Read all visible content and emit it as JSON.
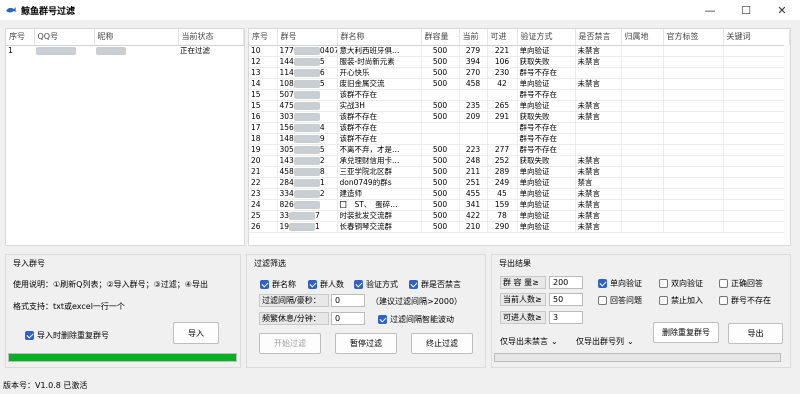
{
  "window": {
    "title": "鲸鱼群号过滤",
    "minimize": "—",
    "maximize": "☐",
    "close": "✕"
  },
  "accounts": {
    "columns": [
      "序号",
      "QQ号",
      "昵称",
      "当前状态"
    ],
    "rows": [
      {
        "index": "1",
        "status": "正在过滤"
      }
    ]
  },
  "groups": {
    "columns": [
      "序号",
      "群号",
      "群名称",
      "群容量",
      "当前",
      "可进",
      "验证方式",
      "是否禁言",
      "归属地",
      "官方标签",
      "关键词"
    ],
    "rows": [
      {
        "idx": "10",
        "num": "177",
        "num_end": "0407",
        "name": "意大利西班牙俱…",
        "cap": "500",
        "cur": "279",
        "can": "221",
        "verify": "单向验证",
        "mute": "未禁言"
      },
      {
        "idx": "12",
        "num": "144",
        "num_end": "5",
        "name": "服装-时尚新元素",
        "cap": "500",
        "cur": "394",
        "can": "106",
        "verify": "获取失败",
        "mute": "未禁言"
      },
      {
        "idx": "13",
        "num": "114",
        "num_end": "6",
        "name": "开心快乐",
        "cap": "500",
        "cur": "270",
        "can": "230",
        "verify": "群号不存在",
        "mute": ""
      },
      {
        "idx": "14",
        "num": "108",
        "num_end": "5",
        "name": "废旧金属交流",
        "cap": "500",
        "cur": "458",
        "can": "42",
        "verify": "单向验证",
        "mute": "未禁言"
      },
      {
        "idx": "15",
        "num": "507",
        "num_end": "",
        "name": "该群不存在",
        "cap": "",
        "cur": "",
        "can": "",
        "verify": "群号不存在",
        "mute": ""
      },
      {
        "idx": "15",
        "num": "475",
        "num_end": "",
        "name": "实战3H",
        "cap": "500",
        "cur": "235",
        "can": "265",
        "verify": "单向验证",
        "mute": "未禁言"
      },
      {
        "idx": "16",
        "num": "303",
        "num_end": "",
        "name": "该群不存在",
        "cap": "500",
        "cur": "209",
        "can": "291",
        "verify": "获取失败",
        "mute": "未禁言"
      },
      {
        "idx": "17",
        "num": "156",
        "num_end": "4",
        "name": "该群不存在",
        "cap": "",
        "cur": "",
        "can": "",
        "verify": "群号不存在",
        "mute": ""
      },
      {
        "idx": "18",
        "num": "148",
        "num_end": "9",
        "name": "该群不存在",
        "cap": "",
        "cur": "",
        "can": "",
        "verify": "群号不存在",
        "mute": ""
      },
      {
        "idx": "19",
        "num": "305",
        "num_end": "5",
        "name": "不离不弃，才是…",
        "cap": "500",
        "cur": "223",
        "can": "277",
        "verify": "群号不存在",
        "mute": ""
      },
      {
        "idx": "20",
        "num": "143",
        "num_end": "2",
        "name": "承兑理财信用卡…",
        "cap": "500",
        "cur": "248",
        "can": "252",
        "verify": "获取失败",
        "mute": "未禁言"
      },
      {
        "idx": "21",
        "num": "458",
        "num_end": "8",
        "name": "三亚学院北区群",
        "cap": "500",
        "cur": "211",
        "can": "289",
        "verify": "单向验证",
        "mute": "未禁言"
      },
      {
        "idx": "22",
        "num": "284",
        "num_end": "1",
        "name": "don0749的群s",
        "cap": "500",
        "cur": "251",
        "can": "249",
        "verify": "单向验证",
        "mute": "禁言"
      },
      {
        "idx": "23",
        "num": "334",
        "num_end": "2",
        "name": "建造师",
        "cap": "500",
        "cur": "455",
        "can": "45",
        "verify": "单向验证",
        "mute": "未禁言"
      },
      {
        "idx": "24",
        "num": "826",
        "num_end": "",
        "name": "囗　ST、　蛋碎…",
        "cap": "500",
        "cur": "341",
        "can": "159",
        "verify": "单向验证",
        "mute": "未禁言"
      },
      {
        "idx": "25",
        "num": "33",
        "num_end": "7",
        "name": "时装批发交流群",
        "cap": "500",
        "cur": "422",
        "can": "78",
        "verify": "单向验证",
        "mute": "未禁言"
      },
      {
        "idx": "26",
        "num": "19",
        "num_end": "1",
        "name": "长春铜琴交流群",
        "cap": "500",
        "cur": "210",
        "can": "290",
        "verify": "单向验证",
        "mute": "未禁言"
      }
    ]
  },
  "import": {
    "title": "导入群号",
    "usage": "使用说明：①刷新Q列表；②导入群号；③过滤；④导出",
    "format": "格式支持：txt或excel一行一个",
    "dedupe_label": "导入时删除重复群号",
    "dedupe_checked": true,
    "import_button": "导入",
    "progress": 1.0
  },
  "filter": {
    "title": "过滤筛选",
    "checks": [
      {
        "label": "群名称",
        "checked": true
      },
      {
        "label": "群人数",
        "checked": true
      },
      {
        "label": "验证方式",
        "checked": true
      },
      {
        "label": "群是否禁言",
        "checked": true
      }
    ],
    "interval_label": "过滤间隔/豪秒：",
    "interval_value": "0",
    "interval_hint": "（建议过滤间隔>2000）",
    "rest_label": "频繁休息/分钟：",
    "rest_value": "0",
    "smart_label": "过滤间隔智能波动",
    "smart_checked": true,
    "start_button": "开始过滤",
    "pause_button": "暂停过滤",
    "stop_button": "终止过滤"
  },
  "export": {
    "title": "导出结果",
    "fields": [
      {
        "label": "群 容 量≥",
        "value": "200"
      },
      {
        "label": "当前人数≥",
        "value": "50"
      },
      {
        "label": "可进人数≥",
        "value": "3"
      }
    ],
    "checks": [
      {
        "label": "单向验证",
        "checked": true
      },
      {
        "label": "双向验证",
        "checked": false
      },
      {
        "label": "正确回答",
        "checked": false
      },
      {
        "label": "回答问题",
        "checked": false
      },
      {
        "label": "禁止加入",
        "checked": false
      },
      {
        "label": "群号不存在",
        "checked": false
      }
    ],
    "dedupe_button": "删除重复群号",
    "export_button": "导出",
    "select_mute": "仅导出未禁言",
    "select_num": "仅导出群号列",
    "progress": 0.0
  },
  "status": {
    "version": "版本号：V1.0.8 已激活"
  }
}
